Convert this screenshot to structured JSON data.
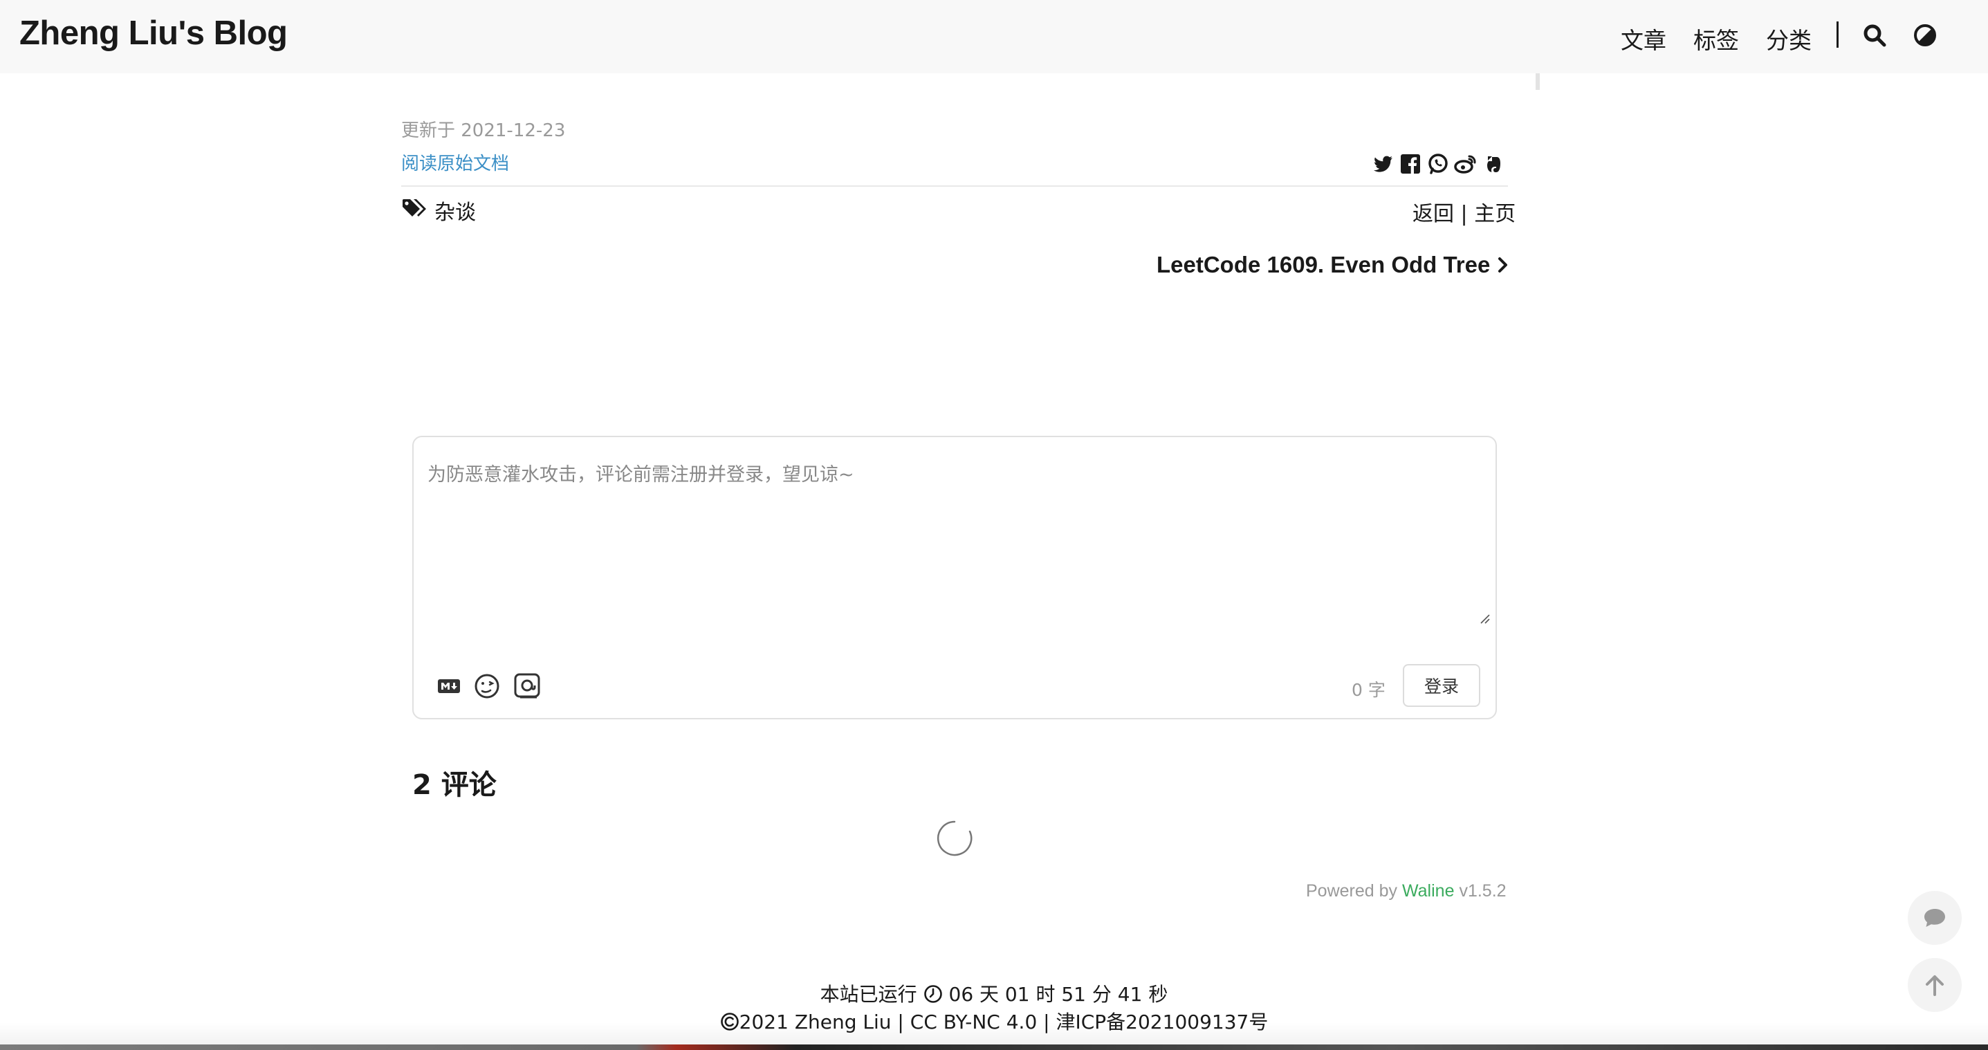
{
  "header": {
    "brand": "Zheng Liu's Blog",
    "nav": [
      "文章",
      "标签",
      "分类"
    ],
    "icons": [
      "search-icon",
      "theme-toggle-icon"
    ]
  },
  "post_meta": {
    "updated": "更新于 2021-12-23",
    "read_original": "阅读原始文档",
    "share_icons": [
      "twitter-icon",
      "facebook-icon",
      "whatsapp-icon",
      "weibo-icon",
      "evernote-icon"
    ],
    "tag": "杂谈",
    "back": "返回",
    "separator": "|",
    "home": "主页",
    "next_post": "LeetCode 1609. Even Odd Tree"
  },
  "comments": {
    "placeholder": "为防恶意灌水攻击，评论前需注册并登录，望见谅~",
    "tool_icons": [
      "markdown-icon",
      "emoji-icon",
      "image-icon"
    ],
    "word_count_value": "0",
    "word_count_unit": "字",
    "login_label": "登录",
    "count_label": "2 评论",
    "powered_prefix": "Powered by",
    "powered_name": "Waline",
    "powered_version": "v1.5.2"
  },
  "footer": {
    "runtime_prefix": "本站已运行",
    "runtime": "06 天 01 时 51 分 41 秒",
    "copyright": "2021 Zheng Liu | CC BY-NC 4.0 |  津ICP备2021009137号"
  },
  "colors": {
    "link": "#3b8fc6",
    "waline": "#3bab5e",
    "muted": "#9a9a9a"
  }
}
